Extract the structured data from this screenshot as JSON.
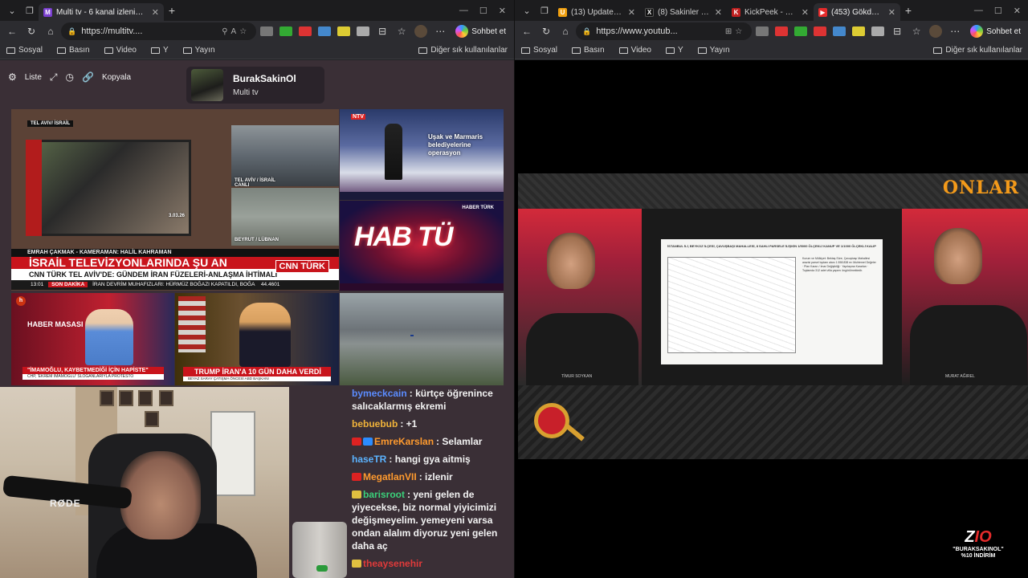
{
  "left_window": {
    "tabs": [
      {
        "title": "Multi tv - 6 kanal izleniyor",
        "active": true
      }
    ],
    "url": "https://multitv....",
    "chat_button": "Sohbet et",
    "bookmarks": [
      "Sosyal",
      "Basın",
      "Video",
      "Y",
      "Yayın"
    ],
    "bookmarks_right": "Diğer sık kullanılanlar",
    "multitv": {
      "list_label": "Liste",
      "copy_label": "Kopyala",
      "profile_name": "BurakSakinOl",
      "profile_sub": "Multi tv"
    },
    "tiles": {
      "main": {
        "tag": "TEL AVIV/ İSRAİL",
        "loc1": "TEL AVİV / İSRAİL CANLI",
        "loc2": "BEYRUT / LÜBNAN",
        "credit": "EMRAH ÇAKMAK - KAMERAMAN: HALİL KAHRAMAN",
        "headline": "İSRAİL TELEVİZYONLARINDA ŞU AN",
        "subline": "CNN TÜRK TEL AVİV'DE: GÜNDEM İRAN FÜZELERİ-ANLAŞMA İHTİMALİ",
        "time": "13:01",
        "son_dakika": "SON DAKİKA",
        "ticker": "İRAN DEVRİM MUHAFIZLARI: HÜRMÜZ BOĞAZI KAPATILDI, BOĞA",
        "index": "44.4601",
        "channel": "CNN TÜRK",
        "date": "3.03.26"
      },
      "ntv": {
        "logo": "NTV",
        "headline": "Uşak ve Marmaris belediyelerine operasyon"
      },
      "habt": {
        "big": "HAB TÜ",
        "logo": "HABER TÜRK"
      },
      "haber_masasi": {
        "title": "HABER MASASI",
        "lower": "\"İMAMOĞLU, KAYBETMEDİĞİ İÇİN HAPİSTE\"",
        "lower2": "CHP, 'EKREM İMAMOĞLU' SLOGANLARIYLA PROTESTO"
      },
      "trump": {
        "lower": "TRUMP İRAN'A 10 GÜN DAHA VERDİ",
        "lower2": "BEYAZ SARAY ÇATIŞMA ÖNCESİ ABD BAŞKANI"
      }
    },
    "webcam_text": "RØDE",
    "chat": [
      {
        "user": "bymeckcain",
        "color": "#5b8cff",
        "badges": [],
        "text": "kürtçe öğrenince salıcaklarmış ekremi"
      },
      {
        "user": "bebuebub",
        "color": "#f0b33a",
        "badges": [],
        "text": "+1"
      },
      {
        "user": "EmreKarslan",
        "color": "#ff9a2e",
        "badges": [
          "#d22",
          "#2b8cff"
        ],
        "text": "Selamlar"
      },
      {
        "user": "haseTR",
        "color": "#5bb3ff",
        "badges": [],
        "text": "hangi gya aitmiş"
      },
      {
        "user": "MegatlanVII",
        "color": "#ff9a2e",
        "badges": [
          "#d22"
        ],
        "text": "izlenir"
      },
      {
        "user": "barisroot",
        "color": "#3ad07a",
        "badges": [
          "#e0c040"
        ],
        "text": "yeni gelen de yiyecekse, biz normal yiyicimizi değişmeyelim. yemeyeni varsa ondan alalım diyoruz yeni gelen daha aç"
      },
      {
        "user": "theaysenehir",
        "color": "#e03a3a",
        "badges": [
          "#e0c040"
        ],
        "text": ""
      }
    ]
  },
  "right_window": {
    "tabs": [
      {
        "title": "(13) Updates Iran wa",
        "fav_color": "#f0a010",
        "active": false
      },
      {
        "title": "(8) Sakinler Topluluk",
        "fav_color": "#111",
        "active": false
      },
      {
        "title": "KickPeek - Kick.com",
        "fav_color": "#c02020",
        "active": false
      },
      {
        "title": "(453) Gökdelenl",
        "fav_color": "#e52b2b",
        "active": true
      }
    ],
    "url": "https://www.youtub...",
    "chat_button": "Sohbet et",
    "bookmarks": [
      "Sosyal",
      "Basın",
      "Video",
      "Y",
      "Yayın"
    ],
    "bookmarks_right": "Diğer sık kullanılanlar",
    "video": {
      "brand": "ONLAR",
      "host_left": "TİMUR SOYKAN",
      "host_right": "MURAT AĞIREL",
      "doc_title": "İSTANBUL İLİ, BEYKOZ İLÇESİ, ÇAVUŞBAŞI MAHALLESİ, 8 SAHLI PARSELE İLİŞKİN 1/5000 ÖLÇEKLİ KANUP VE 1/1000 ÖLÇEKLİ KALIP",
      "doc_text": "Kurum ve Mülkiyet: Bektaş Sûre, Çavuşbaşı Mahallesi arazisi parsel toplam alanı 1.558.838 m² Muhtemel Değeler · Plan Kararı / İmar Değişikliği · Yapılaşma Kararları · Toplamda 312 adet villa yapımı öngörülmektedir."
    },
    "promo": {
      "logo_main": "Z",
      "logo_accent": "IO",
      "line1": "\"BURAKSAKINOL\"",
      "line2": "%10 İNDİRİM"
    }
  },
  "colors": {
    "browser_bg": "#202124",
    "tabbar_bg": "#1c1c1e",
    "toolbar_bg": "#2c2c30",
    "page_bg": "#3a2f36",
    "accent_red": "#c8141c",
    "onlar_orange": "#f39a1a"
  }
}
